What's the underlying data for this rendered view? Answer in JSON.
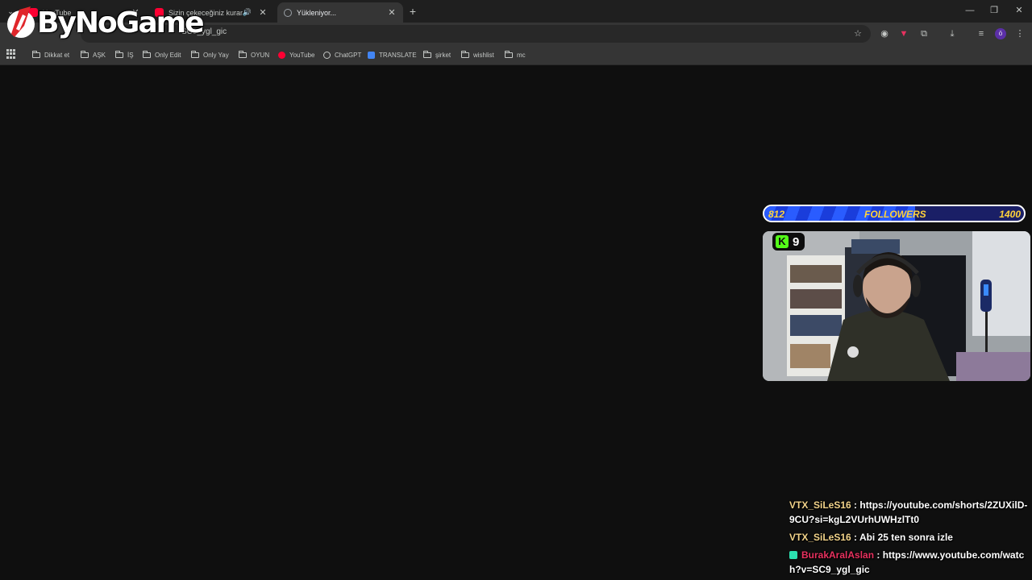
{
  "browser": {
    "tabs": [
      {
        "title": "YouTube",
        "favicon_color": "#ff0033"
      },
      {
        "title": "Sizin çekeceğiniz kuranın...",
        "favicon_color": "#ff0033"
      },
      {
        "title": "Yükleniyor...",
        "favicon_color": "#9aa0a6"
      }
    ],
    "url": "SC9_ygl_gic",
    "profile_initial": "ö",
    "bookmarks": [
      {
        "label": "Dikkat et",
        "type": "folder"
      },
      {
        "label": "AŞK",
        "type": "folder"
      },
      {
        "label": "İŞ",
        "type": "folder"
      },
      {
        "label": "Only Edit",
        "type": "folder"
      },
      {
        "label": "Only Yay",
        "type": "folder"
      },
      {
        "label": "OYUN",
        "type": "folder"
      },
      {
        "label": "YouTube",
        "type": "youtube"
      },
      {
        "label": "ChatGPT",
        "type": "chatgpt"
      },
      {
        "label": "TRANSLATE",
        "type": "translate"
      },
      {
        "label": "şirket",
        "type": "folder"
      },
      {
        "label": "wishlist",
        "type": "folder"
      },
      {
        "label": "mc",
        "type": "folder"
      }
    ]
  },
  "overlay": {
    "logo_text": "ByNoGame",
    "followers": {
      "current": "812",
      "label": "FOLLOWERS",
      "goal": "1400",
      "progress": 0.58
    },
    "kick_badge": {
      "count": "9",
      "brand_color": "#53fc18"
    },
    "chat": [
      {
        "user": "VTX_SiLeS16",
        "text": " : https://youtube.com/shorts/2ZUXilD-9CU?si=kgL2VUrhUWHzlTt0",
        "color": "#f2d38a"
      },
      {
        "user": "VTX_SiLeS16",
        "text": " : Abi 25 ten sonra izle",
        "color": "#f2d38a"
      },
      {
        "user": "BurakAralAslan",
        "text": " : https://www.youtube.com/watch?v=SC9_ygl_gic",
        "color": "#e8315f",
        "icon": true
      }
    ]
  }
}
